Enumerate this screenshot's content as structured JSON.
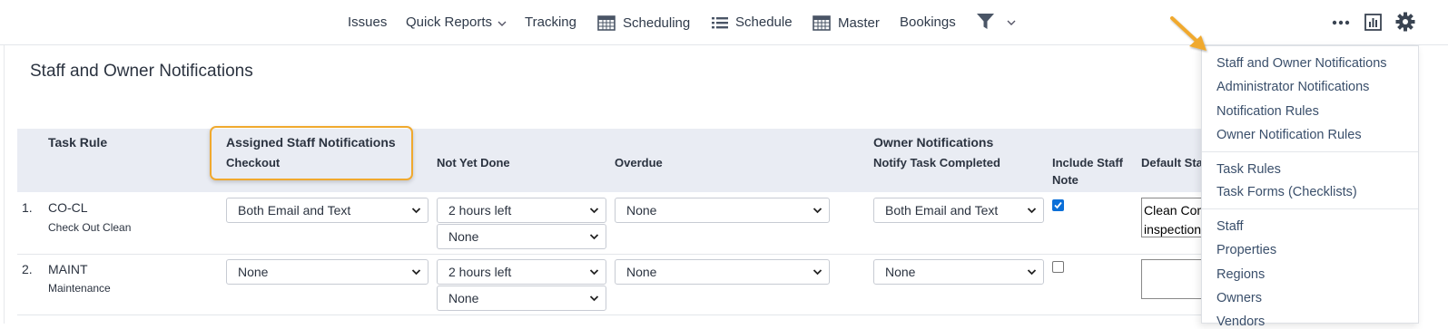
{
  "nav": {
    "items": [
      {
        "label": "Issues"
      },
      {
        "label": "Quick Reports"
      },
      {
        "label": "Tracking"
      },
      {
        "label": "Scheduling"
      },
      {
        "label": "Schedule"
      },
      {
        "label": "Master"
      },
      {
        "label": "Bookings"
      }
    ]
  },
  "page": {
    "title": "Staff and Owner Notifications"
  },
  "table": {
    "headers": {
      "task_rule": "Task Rule",
      "assigned_group": "Assigned Staff Notifications",
      "checkout": "Checkout",
      "not_yet_done": "Not Yet Done",
      "overdue": "Overdue",
      "owner_group": "Owner Notifications",
      "notify_completed": "Notify Task Completed",
      "include_staff_note_1": "Include Staff",
      "include_staff_note_2": "Note",
      "default_staff": "Default Staf"
    },
    "rows": [
      {
        "num": "1.",
        "code": "CO-CL",
        "name": "Check Out Clean",
        "checkout": "Both Email and Text",
        "not_yet_done_1": "2 hours left",
        "not_yet_done_2": "None",
        "overdue": "None",
        "notify_completed": "Both Email and Text",
        "include_staff_note": true,
        "default_note": "Clean Com\ninspection"
      },
      {
        "num": "2.",
        "code": "MAINT",
        "name": "Maintenance",
        "checkout": "None",
        "not_yet_done_1": "2 hours left",
        "not_yet_done_2": "None",
        "overdue": "None",
        "notify_completed": "None",
        "include_staff_note": false,
        "default_note": ""
      }
    ]
  },
  "menu": {
    "items": [
      {
        "label": "Staff and Owner Notifications"
      },
      {
        "label": "Administrator Notifications"
      },
      {
        "label": "Notification Rules"
      },
      {
        "label": "Owner Notification Rules"
      },
      {
        "label": "Task Rules"
      },
      {
        "label": "Task Forms (Checklists)"
      },
      {
        "label": "Staff"
      },
      {
        "label": "Properties"
      },
      {
        "label": "Regions"
      },
      {
        "label": "Owners"
      },
      {
        "label": "Vendors"
      }
    ]
  },
  "icons": {
    "filter": "filter-icon",
    "more": "more-icon",
    "reports": "bar-chart-icon",
    "settings": "gear-icon",
    "calendar": "calendar-icon",
    "list": "list-icon"
  },
  "colors": {
    "highlight": "#f0a92e",
    "header_bg": "#e9ecf3",
    "menu_text": "#3a4f6b",
    "checkbox": "#0b6fd8"
  }
}
